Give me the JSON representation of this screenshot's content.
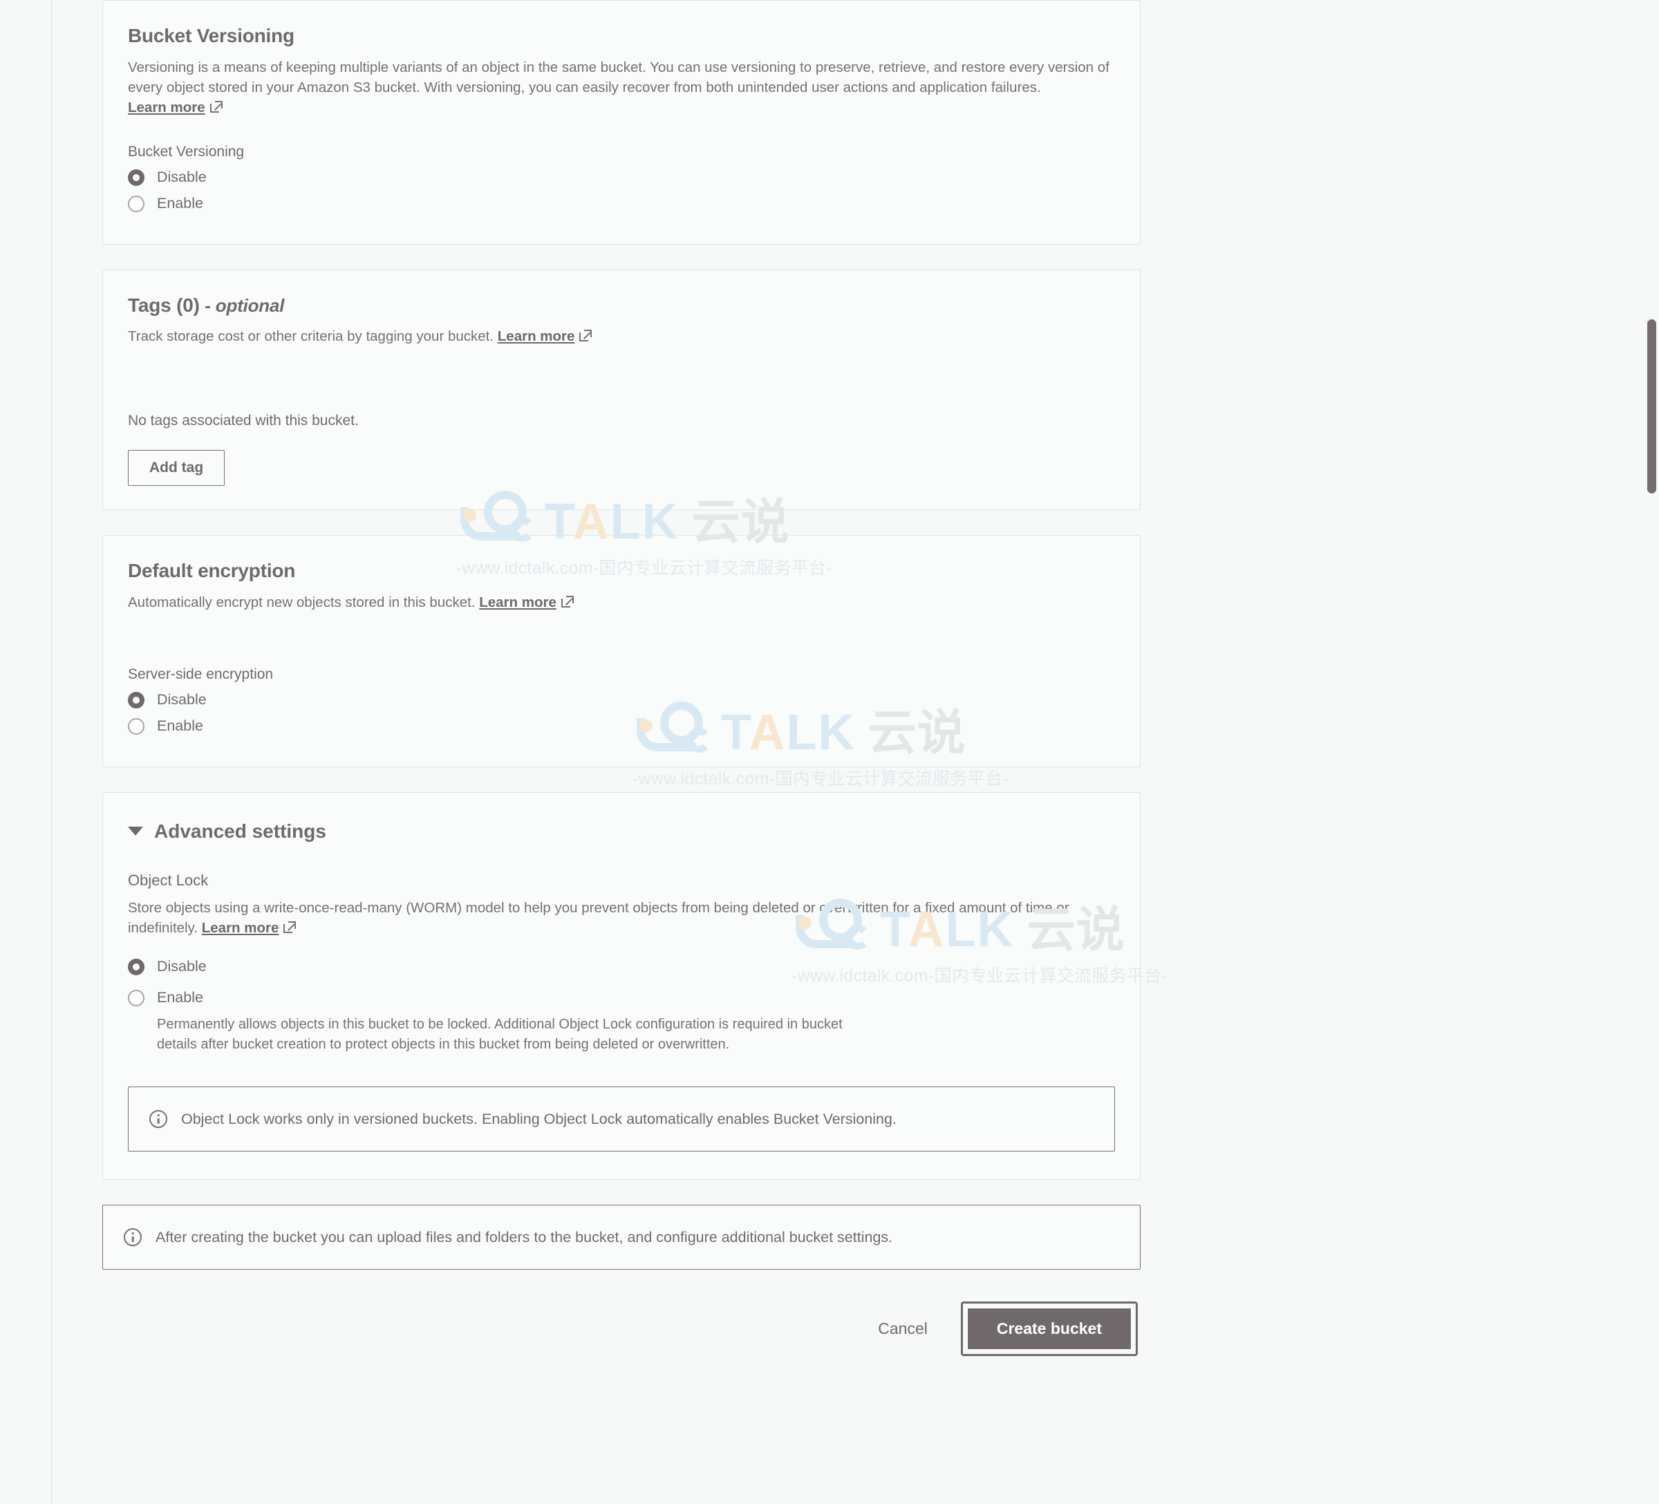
{
  "sections": {
    "versioning": {
      "title": "Bucket Versioning",
      "description": "Versioning is a means of keeping multiple variants of an object in the same bucket. You can use versioning to preserve, retrieve, and restore every version of every object stored in your Amazon S3 bucket. With versioning, you can easily recover from both unintended user actions and application failures.",
      "learn_more": "Learn more",
      "field_label": "Bucket Versioning",
      "options": [
        {
          "label": "Disable",
          "selected": true
        },
        {
          "label": "Enable",
          "selected": false
        }
      ]
    },
    "tags": {
      "title": "Tags",
      "count": "(0)",
      "optional": "- optional",
      "description": "Track storage cost or other criteria by tagging your bucket.",
      "learn_more": "Learn more",
      "empty_text": "No tags associated with this bucket.",
      "add_button": "Add tag"
    },
    "encryption": {
      "title": "Default encryption",
      "description": "Automatically encrypt new objects stored in this bucket.",
      "learn_more": "Learn more",
      "field_label": "Server-side encryption",
      "options": [
        {
          "label": "Disable",
          "selected": true
        },
        {
          "label": "Enable",
          "selected": false
        }
      ]
    },
    "advanced": {
      "header": "Advanced settings",
      "object_lock": {
        "label": "Object Lock",
        "description": "Store objects using a write-once-read-many (WORM) model to help you prevent objects from being deleted or overwritten for a fixed amount of time or indefinitely.",
        "learn_more": "Learn more",
        "options": [
          {
            "label": "Disable",
            "selected": true,
            "sub": ""
          },
          {
            "label": "Enable",
            "selected": false,
            "sub": "Permanently allows objects in this bucket to be locked. Additional Object Lock configuration is required in bucket details after bucket creation to protect objects in this bucket from being deleted or overwritten."
          }
        ],
        "alert": "Object Lock works only in versioned buckets. Enabling Object Lock automatically enables Bucket Versioning."
      }
    }
  },
  "footer": {
    "alert": "After creating the bucket you can upload files and folders to the bucket, and configure additional bucket settings.",
    "cancel_label": "Cancel",
    "create_label": "Create bucket"
  },
  "watermark": {
    "word_before": "T",
    "word_a": "A",
    "word_after": "LK",
    "cn": "云说",
    "sub": "-www.idctalk.com-国内专业云计算交流服务平台-"
  },
  "colors": {
    "text": "#6f6a6b",
    "muted": "#77716f",
    "border": "#e3e4e4",
    "primary_button": "#6f696b",
    "watermark_blue": "#d9e9f4",
    "watermark_cream": "#f8e7cf",
    "watermark_gray": "#e5e6e6"
  }
}
